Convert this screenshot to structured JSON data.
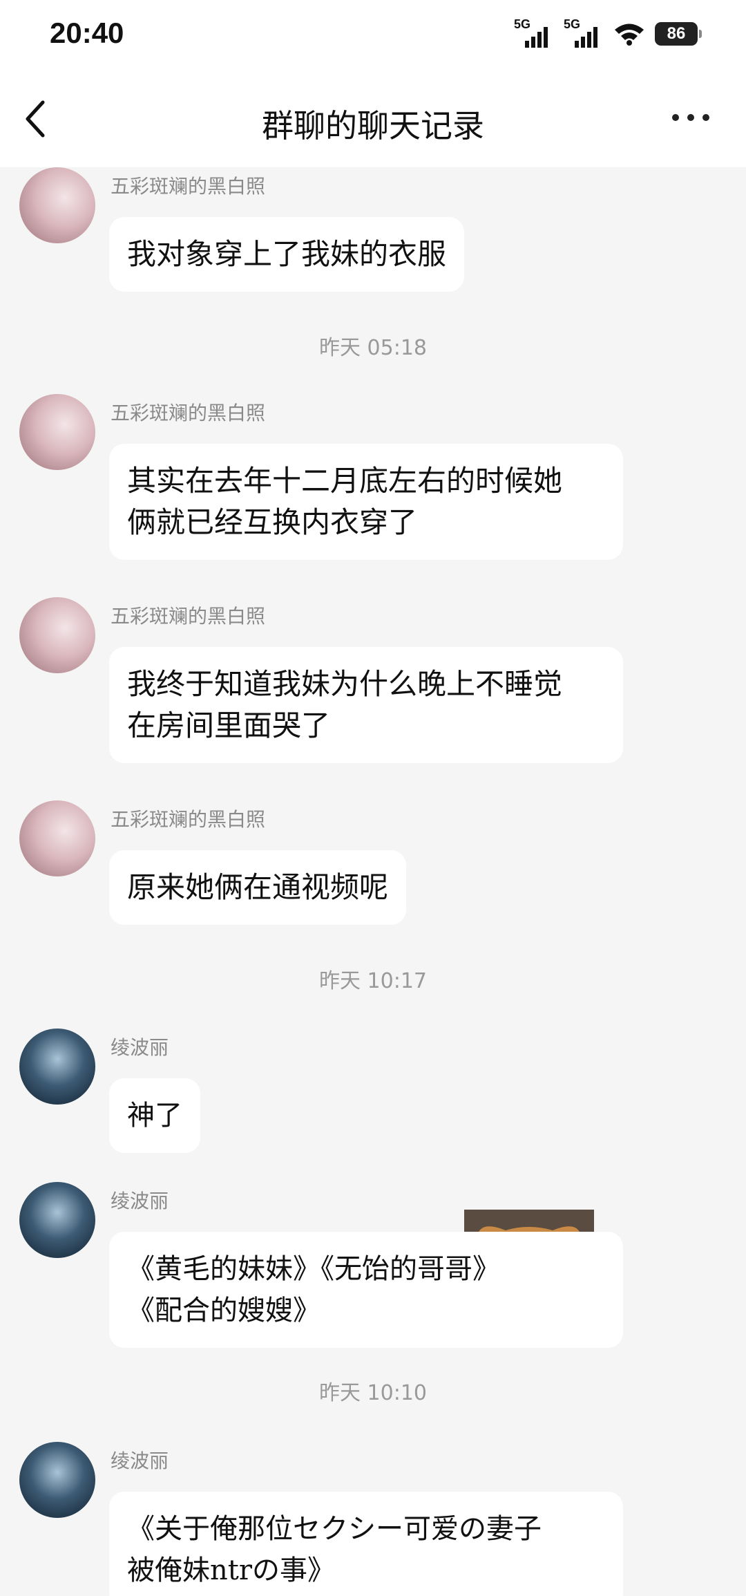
{
  "status_bar": {
    "time": "20:40",
    "signal_1": "5G",
    "signal_2": "5G",
    "battery": "86"
  },
  "nav": {
    "title": "群聊的聊天记录",
    "back_icon": "chevron-left-icon",
    "more_icon": "more-dots-icon"
  },
  "messages": [
    {
      "sender": "五彩斑斓的黑白照",
      "text": "我对象穿上了我妹的衣服"
    },
    {
      "timestamp": "昨天 05:18"
    },
    {
      "sender": "五彩斑斓的黑白照",
      "line1": "其实在去年十二月底左右的时候她",
      "line2": "俩就已经互换内衣穿了"
    },
    {
      "sender": "五彩斑斓的黑白照",
      "line1": "我终于知道我妹为什么晚上不睡觉",
      "line2": "在房间里面哭了"
    },
    {
      "sender": "五彩斑斓的黑白照",
      "text": "原来她俩在通视频呢"
    },
    {
      "timestamp": "昨天 10:17"
    },
    {
      "sender": "绫波丽",
      "text": "神了",
      "sticker": "puppy-sticker"
    },
    {
      "sender": "绫波丽",
      "line1": "《黄毛的妹妹》《无饴的哥哥》",
      "line2": "《配合的嫂嫂》"
    },
    {
      "timestamp": "昨天 10:10"
    },
    {
      "sender": "绫波丽",
      "line1": "《关于俺那位セクシー可爱の妻子",
      "line2": "被俺妹ntrの事》"
    }
  ],
  "colors": {
    "background": "#f5f5f5",
    "bubble": "#ffffff",
    "meta_text": "#999999"
  }
}
